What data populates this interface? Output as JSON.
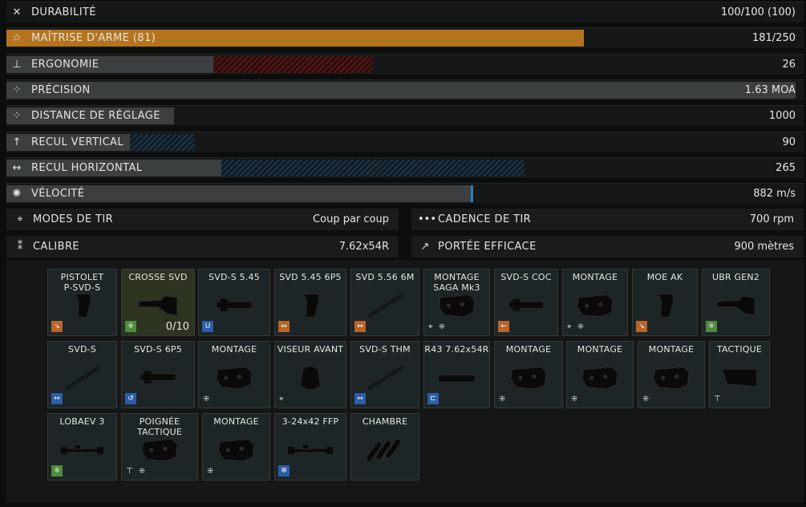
{
  "stats": [
    {
      "icon": "tools-icon",
      "glyph": "✕",
      "label": "DURABILITÉ",
      "value": "100/100 (100)",
      "fill_fraction": 0,
      "color": "#3c3f40"
    },
    {
      "icon": "star-icon",
      "glyph": "☆",
      "label": "MAÎTRISE D'ARME (81)",
      "value": "181/250",
      "fill_fraction": 0.724,
      "color": "#b4741f"
    },
    {
      "icon": "ergonomics-icon",
      "glyph": "⊥",
      "label": "ERGONOMIE",
      "value": "26",
      "fill_fraction": 0.26,
      "delta_fraction": -0.2,
      "color": "#3c3f40"
    },
    {
      "icon": "precision-icon",
      "glyph": "⁘",
      "label": "PRÉCISION",
      "value": "1.63 MOA",
      "fill_fraction": 0.99,
      "color": "#3c3f40"
    },
    {
      "icon": "zeroing-icon",
      "glyph": "⁘",
      "label": "DISTANCE DE RÉGLAGE",
      "value": "1000",
      "fill_fraction": 0.21,
      "color": "#3c3f40"
    },
    {
      "icon": "vertical-recoil-icon",
      "glyph": "↑",
      "label": "RECUL VERTICAL",
      "value": "90",
      "fill_fraction": 0.155,
      "delta_fraction": 0.08,
      "color": "#3c3f40"
    },
    {
      "icon": "horizontal-recoil-icon",
      "glyph": "↔",
      "label": "RECUL HORIZONTAL",
      "value": "265",
      "fill_fraction": 0.27,
      "delta_fraction": 0.38,
      "color": "#3c3f40"
    },
    {
      "icon": "velocity-icon",
      "glyph": "✺",
      "label": "VÉLOCITÉ",
      "value": "882 m/s",
      "fill_fraction": 0.582,
      "color": "#3c3f40"
    }
  ],
  "info": [
    {
      "icon": "fire-mode-icon",
      "glyph": "⌖",
      "label": "MODES DE TIR",
      "value": "Coup par coup"
    },
    {
      "icon": "fire-rate-icon",
      "glyph": "•••",
      "label": "CADENCE DE TIR",
      "value": "700 rpm"
    },
    {
      "icon": "caliber-icon",
      "glyph": "⁑",
      "label": "CALIBRE",
      "value": "7.62x54R"
    },
    {
      "icon": "effective-range-icon",
      "glyph": "↗",
      "label": "PORTÉE EFFICACE",
      "value": "900 mètres"
    }
  ],
  "mods": [
    [
      {
        "name": "PISTOLET\nP-SVD-S",
        "badge": "orange",
        "badge_glyph": "↘",
        "icon": "pistol-grip-icon"
      },
      {
        "name": "CROSSE SVD",
        "badge": "green",
        "badge_glyph": "⁜",
        "icon": "stock-icon",
        "count": "0/10",
        "highlight": true
      },
      {
        "name": "SVD-S 5.45",
        "badge": "blue",
        "badge_glyph": "U",
        "icon": "handguard-icon"
      },
      {
        "name": "SVD 5.45 6P5",
        "badge": "orange",
        "badge_glyph": "↔",
        "icon": "grip-icon"
      },
      {
        "name": "SVD 5.56 6M",
        "badge": "orange",
        "badge_glyph": "↔",
        "icon": "barrel-icon"
      },
      {
        "name": "MONTAGE\nSAGA Mk3",
        "slot_icons": "⌖ ⁜",
        "icon": "mount-icon"
      },
      {
        "name": "SVD-S COC",
        "badge": "orange",
        "badge_glyph": "←",
        "icon": "cover-icon"
      },
      {
        "name": "MONTAGE",
        "slot_icons": "⌖ ⁜",
        "icon": "mount-icon"
      },
      {
        "name": "MOE AK",
        "badge": "orange",
        "badge_glyph": "↘",
        "icon": "pistol-grip-icon"
      },
      {
        "name": "UBR GEN2",
        "badge": "green",
        "badge_glyph": "⁜",
        "icon": "stock-icon"
      }
    ],
    [
      {
        "name": "SVD-S",
        "badge": "blue",
        "badge_glyph": "↔",
        "icon": "barrel-icon"
      },
      {
        "name": "SVD-S 6P5",
        "badge": "blue",
        "badge_glyph": "↺",
        "icon": "gas-tube-icon"
      },
      {
        "name": "MONTAGE",
        "slot_icons": "⁜",
        "icon": "mount-icon"
      },
      {
        "name": "VISEUR AVANT",
        "slot_icons": "⌖",
        "icon": "front-sight-icon"
      },
      {
        "name": "SVD-S THM",
        "badge": "blue",
        "badge_glyph": "↔",
        "icon": "barrel-icon"
      },
      {
        "name": "R43 7.62x54R",
        "badge": "blue",
        "badge_glyph": "⊏",
        "icon": "suppressor-icon"
      },
      {
        "name": "MONTAGE",
        "slot_icons": "⁜",
        "icon": "mount-icon"
      },
      {
        "name": "MONTAGE",
        "slot_icons": "⁜",
        "icon": "mount-icon"
      },
      {
        "name": "MONTAGE",
        "slot_icons": "⁜",
        "icon": "mount-icon"
      },
      {
        "name": "TACTIQUE",
        "slot_icons": "⊤",
        "icon": "tactical-icon"
      }
    ],
    [
      {
        "name": "LOBAEV 3",
        "badge": "green",
        "badge_glyph": "⁜",
        "icon": "scope-icon"
      },
      {
        "name": "POIGNÉE TACTIQUE",
        "slot_icons": "⊤ ⁜",
        "icon": "tactical-grip-icon"
      },
      {
        "name": "MONTAGE",
        "slot_icons": "⁜",
        "icon": "mount-icon"
      },
      {
        "name": "3-24x42 FFP",
        "badge": "blue",
        "badge_glyph": "✲",
        "icon": "scope-icon"
      },
      {
        "name": "CHAMBRE",
        "icon": "chamber-icon"
      }
    ]
  ]
}
